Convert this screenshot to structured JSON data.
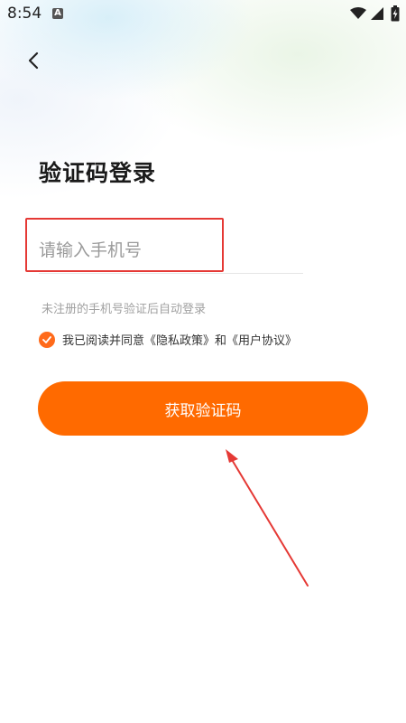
{
  "status_bar": {
    "time": "8:54",
    "notification_letter": "A",
    "icons": [
      "wifi-icon",
      "signal-icon",
      "battery-icon"
    ]
  },
  "nav": {
    "back_icon": "chevron-left-icon"
  },
  "page": {
    "title": "验证码登录"
  },
  "phone_input": {
    "placeholder": "请输入手机号",
    "value": ""
  },
  "hint": "未注册的手机号验证后自动登录",
  "agreement": {
    "checked": true,
    "prefix": "我已阅读并同意",
    "privacy_link": "《隐私政策》",
    "conjunction": "和",
    "user_link": "《用户协议》"
  },
  "submit_button": {
    "label": "获取验证码"
  },
  "colors": {
    "accent": "#ff6a00",
    "annotation": "#e53935",
    "title": "#1a1a1a",
    "hint": "#a0a0a0"
  }
}
